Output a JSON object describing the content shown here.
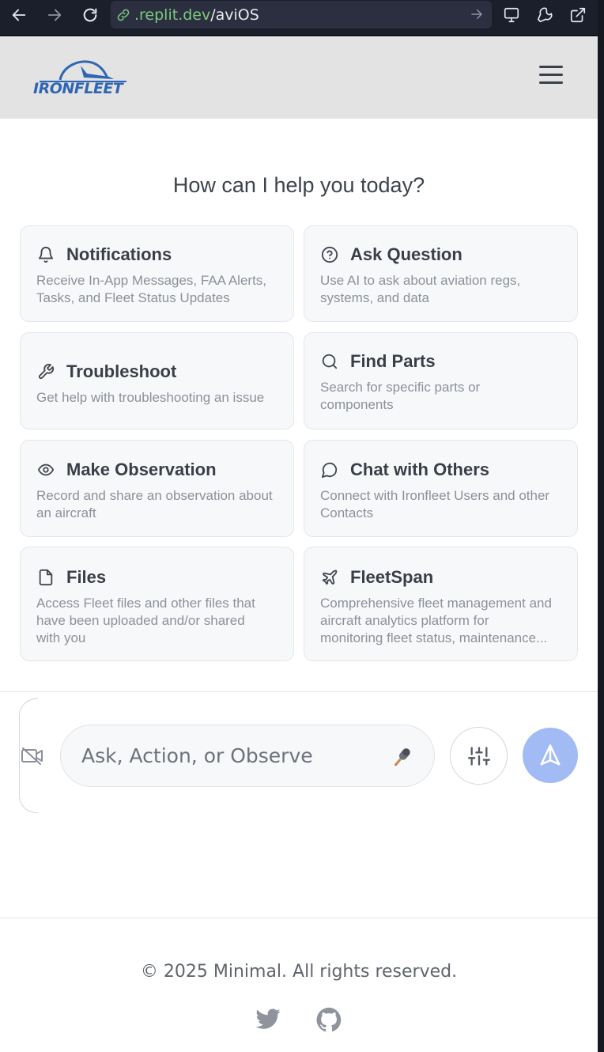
{
  "browser": {
    "url_host": ".replit.dev",
    "url_path": "/aviOS"
  },
  "header": {
    "logo_text": "IRONFLEET",
    "logo_colors": {
      "brand_blue": "#2f66b2"
    }
  },
  "main": {
    "heading": "How can I help you today?",
    "cards": [
      {
        "icon": "bell-icon",
        "title": "Notifications",
        "description": [
          "Receive In-App Messages, FAA Alerts,",
          "Tasks, and Fleet Status Updates"
        ]
      },
      {
        "icon": "question-circle-icon",
        "title": "Ask Question",
        "description": [
          "Use AI to ask about aviation regs,",
          "systems, and data"
        ]
      },
      {
        "icon": "wrench-icon",
        "title": "Troubleshoot",
        "description": [
          "Get help with troubleshooting an issue"
        ]
      },
      {
        "icon": "search-icon",
        "title": "Find Parts",
        "description": [
          "Search for specific parts or",
          "components"
        ]
      },
      {
        "icon": "eye-icon",
        "title": "Make Observation",
        "description": [
          "Record and share an observation about",
          "an aircraft"
        ]
      },
      {
        "icon": "chat-bubble-icon",
        "title": "Chat with Others",
        "description": [
          "Connect with Ironfleet Users and other",
          "Contacts"
        ]
      },
      {
        "icon": "file-icon",
        "title": "Files",
        "description": [
          "Access Fleet files and other files that",
          "have been uploaded and/or shared",
          "with you"
        ]
      },
      {
        "icon": "plane-icon",
        "title": "FleetSpan",
        "description": [
          "Comprehensive fleet management and",
          "aircraft analytics platform for",
          "monitoring fleet status, maintenance..."
        ]
      }
    ]
  },
  "composer": {
    "placeholder": "Ask, Action, or Observe",
    "send_color": "#a3bbf5"
  },
  "footer": {
    "copyright": "© 2025 Minimal. All rights reserved.",
    "social": [
      "twitter-icon",
      "github-icon"
    ]
  }
}
